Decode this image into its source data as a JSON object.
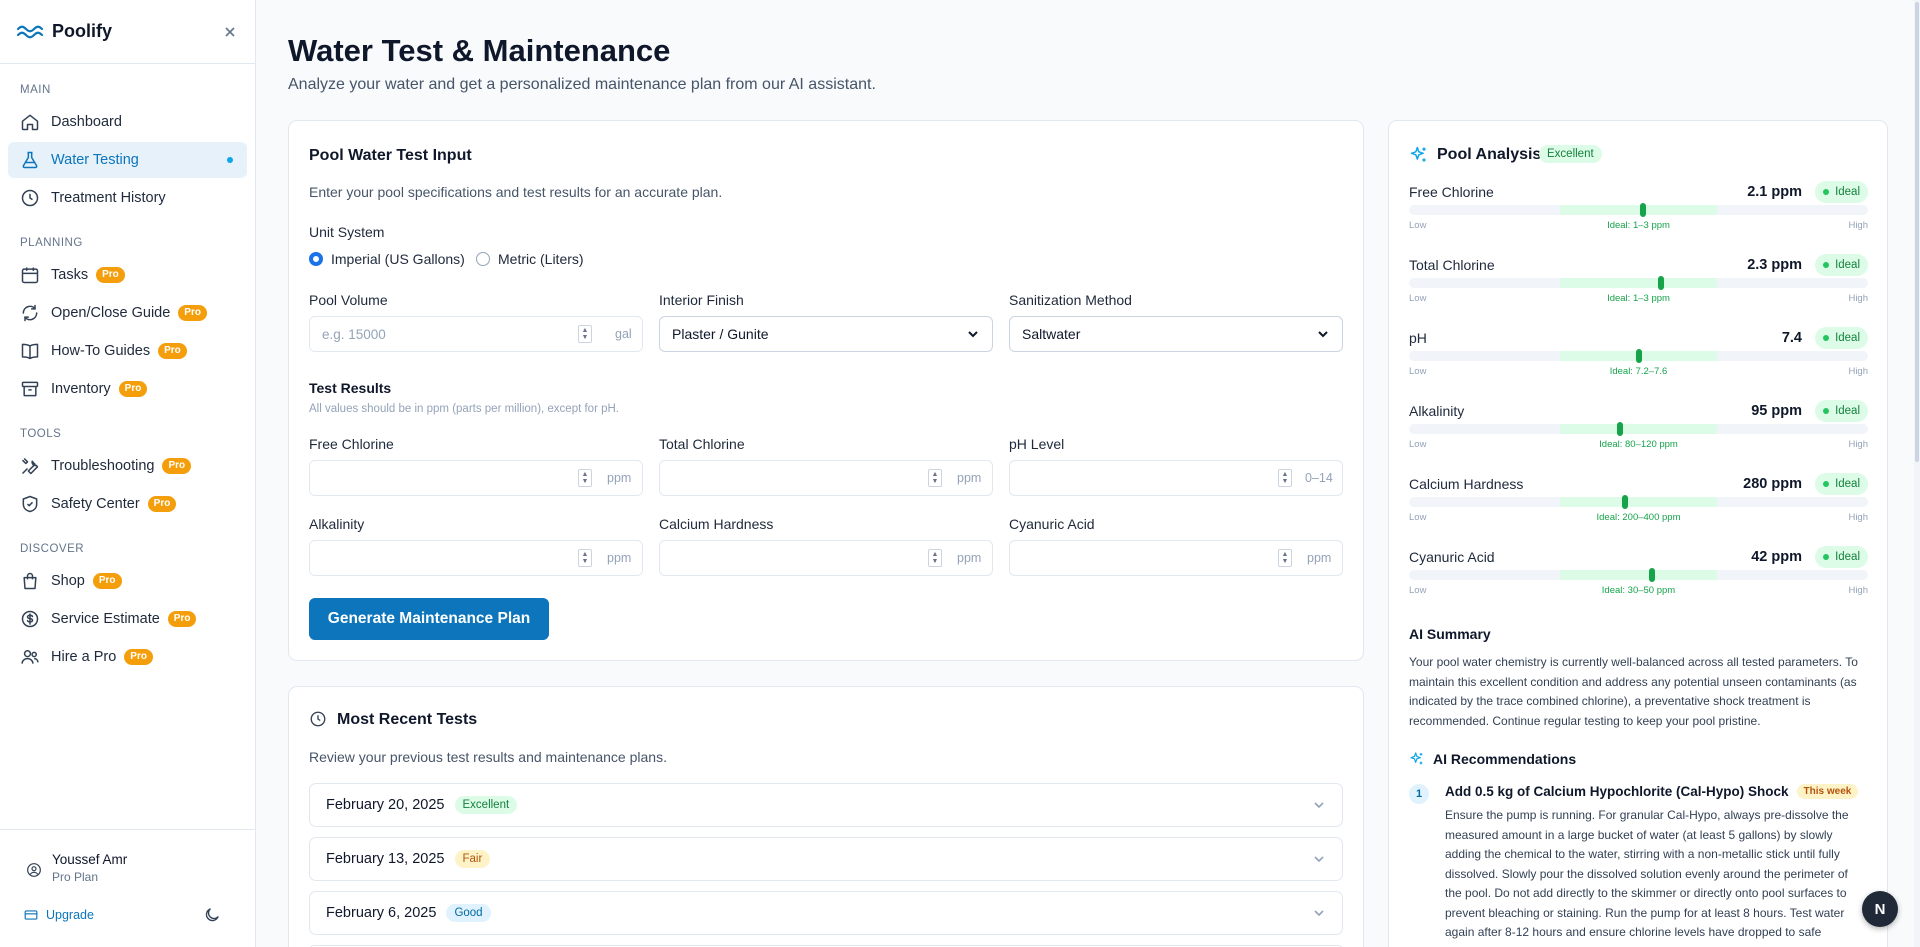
{
  "app": {
    "name": "Poolify"
  },
  "sidebar": {
    "sections": [
      {
        "label": "MAIN",
        "items": [
          {
            "label": "Dashboard",
            "icon": "home-icon"
          },
          {
            "label": "Water Testing",
            "icon": "flask-icon",
            "active": true
          },
          {
            "label": "Treatment History",
            "icon": "clock-icon"
          }
        ]
      },
      {
        "label": "PLANNING",
        "items": [
          {
            "label": "Tasks",
            "icon": "calendar-icon",
            "pro": "Pro"
          },
          {
            "label": "Open/Close Guide",
            "icon": "refresh-icon",
            "pro": "Pro"
          },
          {
            "label": "How-To Guides",
            "icon": "book-icon",
            "pro": "Pro"
          },
          {
            "label": "Inventory",
            "icon": "archive-icon",
            "pro": "Pro"
          }
        ]
      },
      {
        "label": "TOOLS",
        "items": [
          {
            "label": "Troubleshooting",
            "icon": "wrench-icon",
            "pro": "Pro"
          },
          {
            "label": "Safety Center",
            "icon": "shield-icon",
            "pro": "Pro"
          }
        ]
      },
      {
        "label": "DISCOVER",
        "items": [
          {
            "label": "Shop",
            "icon": "shopping-bag-icon",
            "pro": "Pro"
          },
          {
            "label": "Service Estimate",
            "icon": "dollar-icon",
            "pro": "Pro"
          },
          {
            "label": "Hire a Pro",
            "icon": "users-icon",
            "pro": "Pro"
          }
        ]
      }
    ],
    "user": {
      "name": "Youssef Amr",
      "plan": "Pro Plan"
    },
    "upgrade_label": "Upgrade"
  },
  "header": {
    "title": "Water Test & Maintenance",
    "subtitle": "Analyze your water and get a personalized maintenance plan from our AI assistant."
  },
  "form": {
    "title": "Pool Water Test Input",
    "description": "Enter your pool specifications and test results for an accurate plan.",
    "unit_system_label": "Unit System",
    "unit_options": [
      "Imperial (US Gallons)",
      "Metric (Liters)"
    ],
    "unit_selected": "Imperial (US Gallons)",
    "pool_volume": {
      "label": "Pool Volume",
      "placeholder": "e.g. 15000",
      "unit": "gal"
    },
    "interior_finish": {
      "label": "Interior Finish",
      "value": "Plaster / Gunite"
    },
    "sanitization": {
      "label": "Sanitization Method",
      "value": "Saltwater"
    },
    "test_results_title": "Test Results",
    "test_results_note": "All values should be in ppm (parts per million), except for pH.",
    "fields": [
      {
        "label": "Free Chlorine",
        "unit": "ppm"
      },
      {
        "label": "Total Chlorine",
        "unit": "ppm"
      },
      {
        "label": "pH Level",
        "unit": "0–14"
      },
      {
        "label": "Alkalinity",
        "unit": "ppm"
      },
      {
        "label": "Calcium Hardness",
        "unit": "ppm"
      },
      {
        "label": "Cyanuric Acid",
        "unit": "ppm"
      }
    ],
    "submit_label": "Generate Maintenance Plan"
  },
  "recent": {
    "title": "Most Recent Tests",
    "description": "Review your previous test results and maintenance plans.",
    "items": [
      {
        "date": "February 20, 2025",
        "status": "Excellent"
      },
      {
        "date": "February 13, 2025",
        "status": "Fair"
      },
      {
        "date": "February 6, 2025",
        "status": "Good"
      }
    ]
  },
  "analysis": {
    "title": "Pool Analysis",
    "overall": "Excellent",
    "low_label": "Low",
    "high_label": "High",
    "params": [
      {
        "name": "Free Chlorine",
        "value": "2.1 ppm",
        "status": "Ideal",
        "ideal_label": "Ideal: 1–3 ppm",
        "level": 0.51,
        "ideal_range": [
          0.33,
          0.67
        ]
      },
      {
        "name": "Total Chlorine",
        "value": "2.3 ppm",
        "status": "Ideal",
        "ideal_label": "Ideal: 1–3 ppm",
        "level": 0.55,
        "ideal_range": [
          0.33,
          0.67
        ]
      },
      {
        "name": "pH",
        "value": "7.4",
        "status": "Ideal",
        "ideal_label": "Ideal: 7.2–7.6",
        "level": 0.5,
        "ideal_range": [
          0.33,
          0.67
        ]
      },
      {
        "name": "Alkalinity",
        "value": "95 ppm",
        "status": "Ideal",
        "ideal_label": "Ideal: 80–120 ppm",
        "level": 0.46,
        "ideal_range": [
          0.33,
          0.67
        ]
      },
      {
        "name": "Calcium Hardness",
        "value": "280 ppm",
        "status": "Ideal",
        "ideal_label": "Ideal: 200–400 ppm",
        "level": 0.47,
        "ideal_range": [
          0.33,
          0.67
        ]
      },
      {
        "name": "Cyanuric Acid",
        "value": "42 ppm",
        "status": "Ideal",
        "ideal_label": "Ideal: 30–50 ppm",
        "level": 0.53,
        "ideal_range": [
          0.33,
          0.67
        ]
      }
    ],
    "summary_title": "AI Summary",
    "summary": "Your pool water chemistry is currently well-balanced across all tested parameters. To maintain this excellent condition and address any potential unseen contaminants (as indicated by the trace combined chlorine), a preventative shock treatment is recommended. Continue regular testing to keep your pool pristine.",
    "recs_title": "AI Recommendations",
    "recs": [
      {
        "num": "1",
        "title": "Add 0.5 kg of Calcium Hypochlorite (Cal-Hypo) Shock",
        "tag": "This week",
        "body": "Ensure the pump is running. For granular Cal-Hypo, always pre-dissolve the measured amount in a large bucket of water (at least 5 gallons) by slowly adding the chemical to the water, stirring with a non-metallic stick until fully dissolved. Slowly pour the dissolved solution evenly around the perimeter of the pool. Do not add directly to the skimmer or directly onto pool surfaces to prevent bleaching or staining. Run the pump for at least 8 hours. Test water again after 8-12 hours and ensure chlorine levels have dropped to safe"
      }
    ]
  },
  "assistant_button": "N"
}
